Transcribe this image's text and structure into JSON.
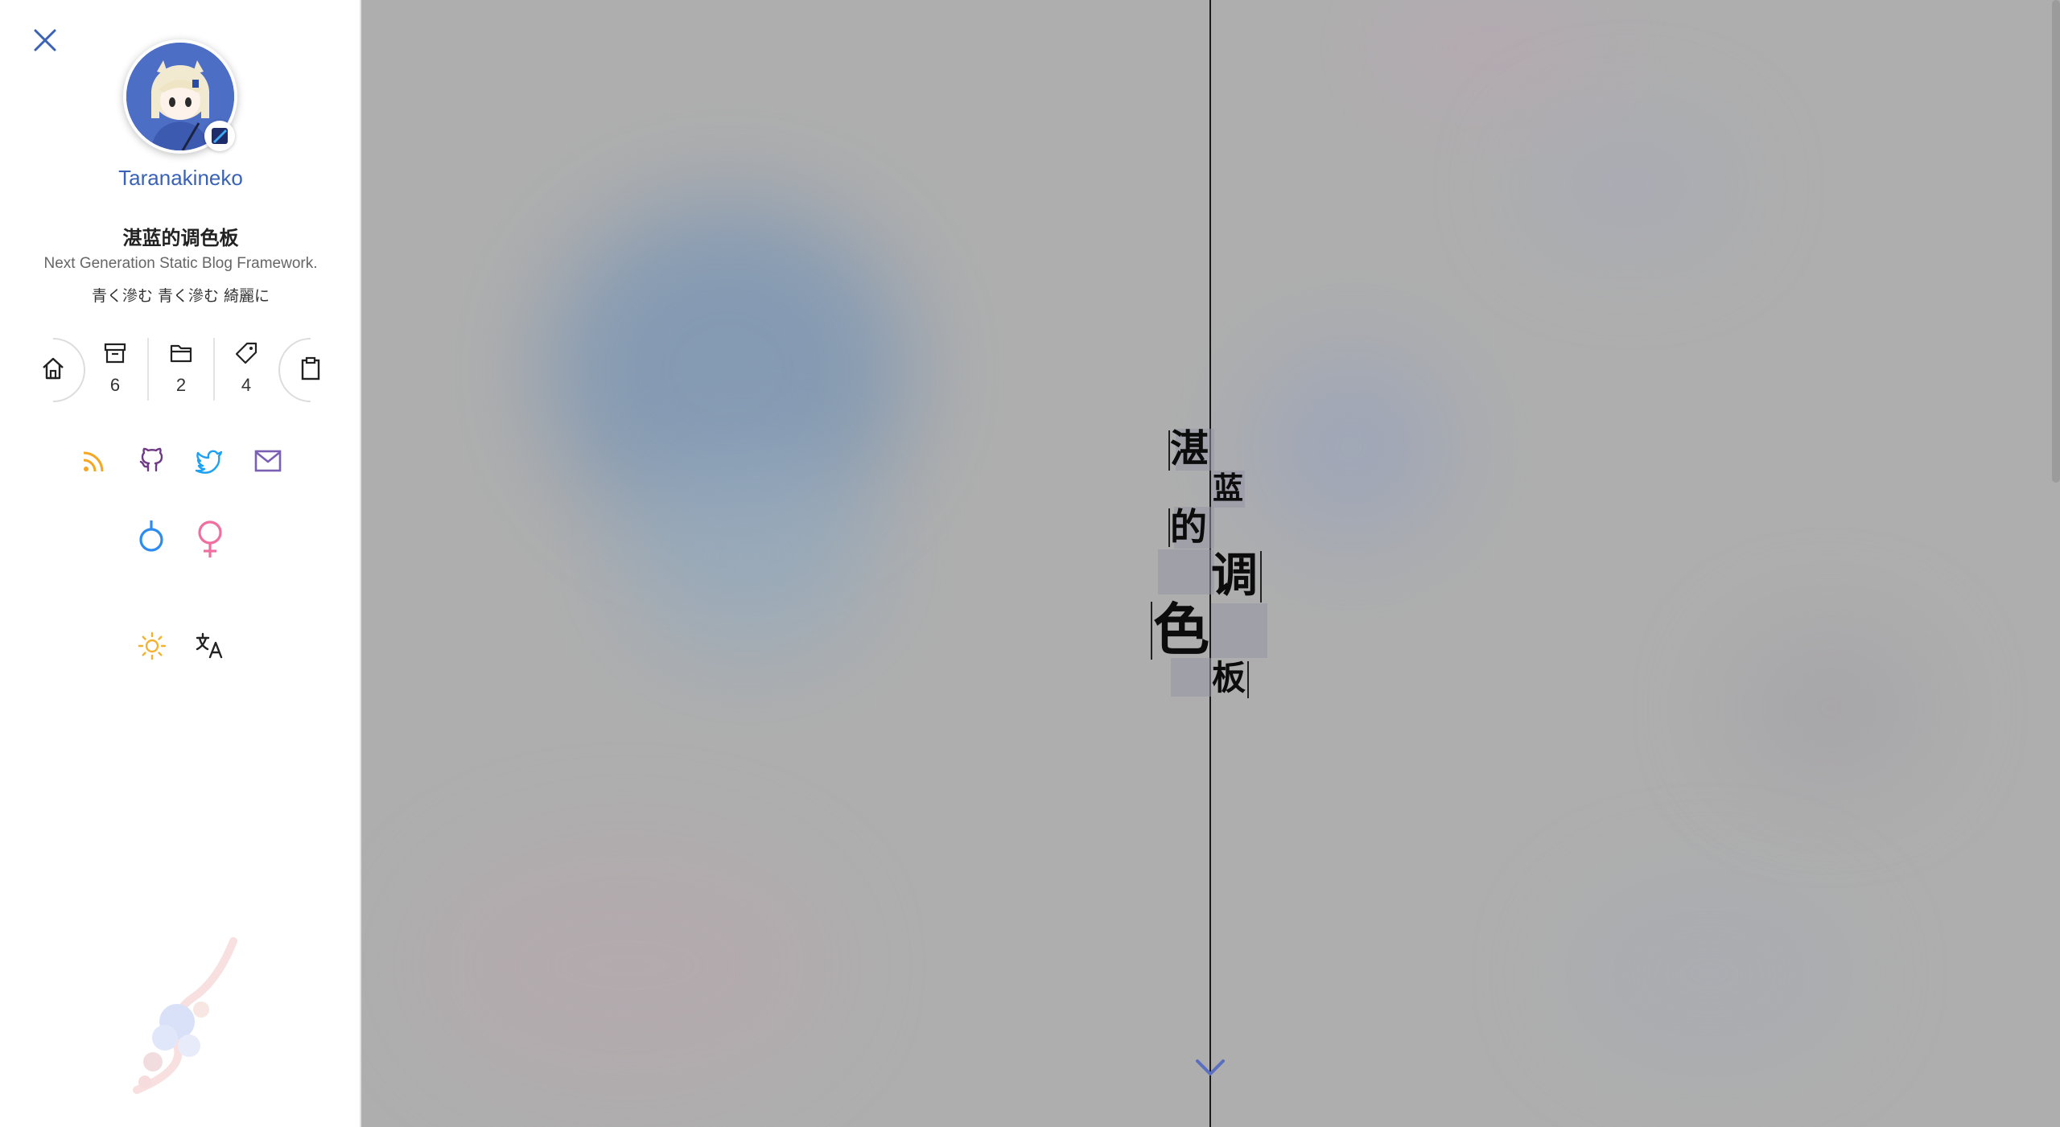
{
  "sidebar": {
    "author": {
      "name": "Taranakineko"
    },
    "site": {
      "title": "湛蓝的调色板",
      "subtitle": "Next Generation Static Blog Framework.",
      "motto": "青く滲む 青く滲む 綺麗に"
    },
    "stats": {
      "home_icon": "home-icon",
      "archives_count": "6",
      "categories_count": "2",
      "tags_count": "4",
      "clipboard_icon": "clipboard-icon"
    },
    "social": [
      {
        "icon": "rss-icon",
        "color": "#f5a623"
      },
      {
        "icon": "github-icon",
        "color": "#6e3a88"
      },
      {
        "icon": "twitter-icon",
        "color": "#1da1f2"
      },
      {
        "icon": "mail-icon",
        "color": "#7a5fb5"
      }
    ],
    "gender_icons": [
      {
        "icon": "male-symbol-icon",
        "color": "#2d8cf0"
      },
      {
        "icon": "female-symbol-icon",
        "color": "#f06fa0"
      }
    ],
    "tools": [
      {
        "icon": "sun-icon",
        "color": "#f5b02e"
      },
      {
        "icon": "translate-icon",
        "color": "#222222"
      }
    ]
  },
  "hero": {
    "title_chars": [
      "湛",
      "蓝",
      "的",
      "调",
      "色",
      "板"
    ],
    "scroll_icon": "chevron-down-icon",
    "accent_color": "#5a6fc0"
  },
  "colors": {
    "link_blue": "#3a62b6",
    "hero_bg": "#aeaeae"
  }
}
